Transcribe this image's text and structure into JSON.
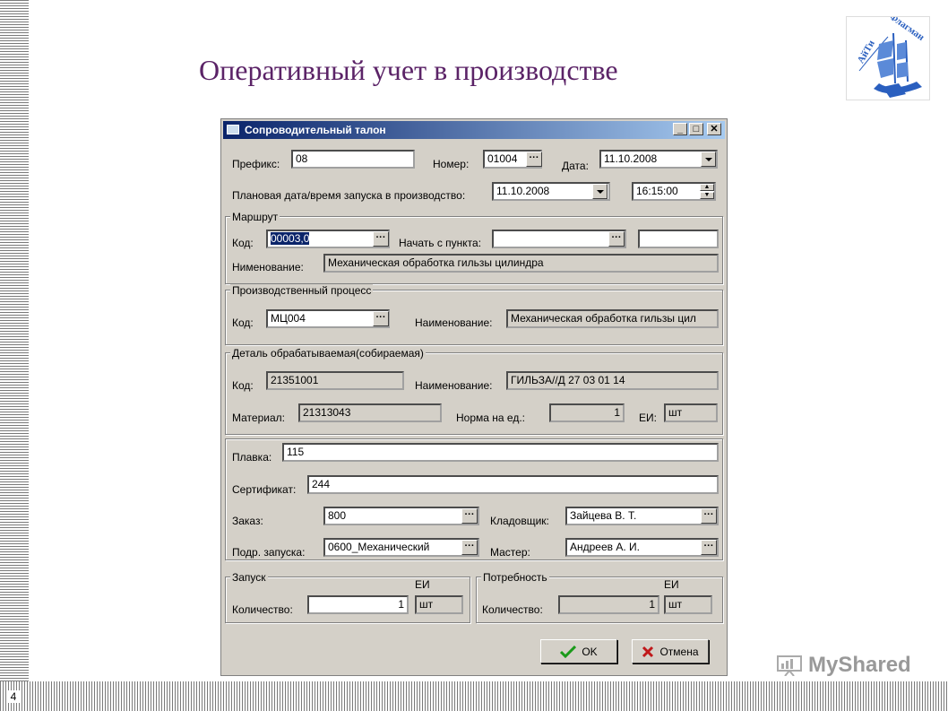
{
  "slide": {
    "title": "Оперативный учет в производстве",
    "page_number": "4",
    "watermark": "MyShared",
    "logo_text": "АйТи Флагман"
  },
  "dialog": {
    "title": "Сопроводительный талон",
    "header": {
      "prefix_label": "Префикс:",
      "prefix_value": "08",
      "number_label": "Номер:",
      "number_value": "01004",
      "date_label": "Дата:",
      "date_value": "11.10.2008",
      "planned_label": "Плановая дата/время запуска в производство:",
      "planned_date": "11.10.2008",
      "planned_time": "16:15:00"
    },
    "route": {
      "group": "Маршрут",
      "code_label": "Код:",
      "code_value": "00003,0",
      "start_label": "Начать с пункта:",
      "start_value": "",
      "start_extra": "",
      "name_label": "Нименование:",
      "name_value": "Механическая обработка гильзы цилиндра"
    },
    "process": {
      "group": "Производственный процесс",
      "code_label": "Код:",
      "code_value": "МЦ004",
      "name_label": "Наименование:",
      "name_value": "Механическая обработка гильзы цил"
    },
    "detail": {
      "group": "Деталь обрабатываемая(собираемая)",
      "code_label": "Код:",
      "code_value": "21351001",
      "name_label": "Наименование:",
      "name_value": "ГИЛЬЗА//Д 27 03 01 14",
      "material_label": "Материал:",
      "material_value": "21313043",
      "norm_label": "Норма на ед.:",
      "norm_value": "1",
      "unit_label": "ЕИ:",
      "unit_value": "шт"
    },
    "extra": {
      "melt_label": "Плавка:",
      "melt_value": "115",
      "cert_label": "Сертификат:",
      "cert_value": "244",
      "order_label": "Заказ:",
      "order_value": "800",
      "keeper_label": "Кладовщик:",
      "keeper_value": "Зайцева В. Т.",
      "dept_label": "Подр. запуска:",
      "dept_value": "0600_Механический",
      "master_label": "Мастер:",
      "master_value": "Андреев А. И."
    },
    "launch": {
      "group": "Запуск",
      "unit_header": "ЕИ",
      "qty_label": "Количество:",
      "qty_value": "1",
      "unit_value": "шт"
    },
    "need": {
      "group": "Потребность",
      "unit_header": "ЕИ",
      "qty_label": "Количество:",
      "qty_value": "1",
      "unit_value": "шт"
    },
    "buttons": {
      "ok": "OK",
      "cancel": "Отмена"
    }
  }
}
